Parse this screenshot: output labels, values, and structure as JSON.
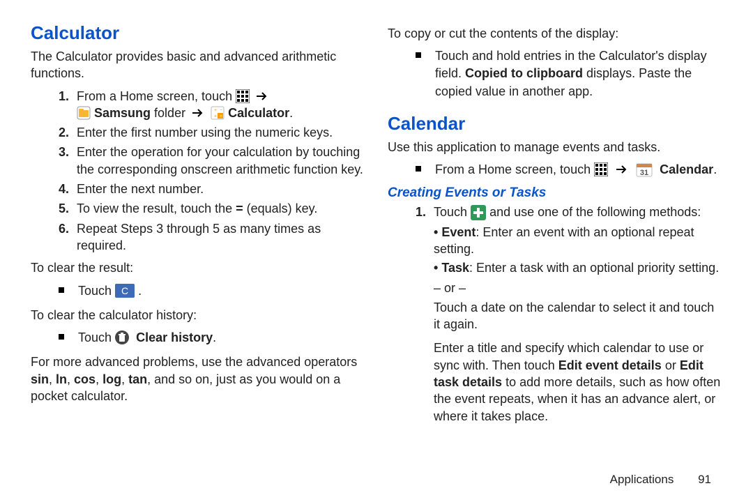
{
  "calculator": {
    "heading": "Calculator",
    "intro": "The Calculator provides basic and advanced arithmetic functions.",
    "step1_pre": "From a Home screen, touch ",
    "step1_samsung": "Samsung",
    "step1_folder": " folder ",
    "step1_calc": "Calculator",
    "step1_period": ".",
    "step2": "Enter the first number using the numeric keys.",
    "step3": "Enter the operation for your calculation by touching the corresponding onscreen arithmetic function key.",
    "step4": "Enter the next number.",
    "step5_pre": "To view the result, touch the ",
    "step5_eq": "=",
    "step5_post": " (equals) key.",
    "step6": "Repeat Steps 3 through 5 as many times as required.",
    "clear_result_intro": "To clear the result:",
    "clear_result_item_pre": "Touch ",
    "clear_result_item_post": " .",
    "clear_history_intro": "To clear the calculator history:",
    "clear_history_item_pre": "Touch ",
    "clear_history_label": "Clear history",
    "clear_history_item_post": ".",
    "advanced_pre": "For more advanced problems, use the advanced operators ",
    "adv_sin": "sin",
    "adv_sep1": ", ",
    "adv_ln": "ln",
    "adv_sep2": ", ",
    "adv_cos": "cos",
    "adv_sep3": ", ",
    "adv_log": "log",
    "adv_sep4": ", ",
    "adv_tan": "tan",
    "advanced_post": ", and so on, just as you would on a pocket calculator.",
    "copy_intro": "To copy or cut the contents of the display:",
    "copy_item_pre": "Touch and hold entries in the Calculator's display field. ",
    "copy_item_bold": "Copied to clipboard",
    "copy_item_post": " displays. Paste the copied value in another app."
  },
  "calendar": {
    "heading": "Calendar",
    "intro": "Use this application to manage events and tasks.",
    "open_pre": "From a Home screen, touch ",
    "open_label": "Calendar",
    "open_post": ".",
    "sub_heading": "Creating Events or Tasks",
    "step1_pre": "Touch ",
    "step1_post": " and use one of the following methods:",
    "event_label": "Event",
    "event_desc": ": Enter an event with an optional repeat setting.",
    "task_label": "Task",
    "task_desc": ": Enter a task with an optional priority setting.",
    "or_text": "– or –",
    "touch_date": "Touch a date on the calendar to select it and touch it again.",
    "enter_title_pre": "Enter a title and specify which calendar to use or sync with. Then touch ",
    "edit_event": "Edit event details",
    "enter_title_mid": " or ",
    "edit_task": "Edit task details",
    "enter_title_post": " to add more details, such as how often the event repeats, when it has an advance alert, or where it takes place."
  },
  "nums": {
    "n1": "1.",
    "n2": "2.",
    "n3": "3.",
    "n4": "4.",
    "n5": "5.",
    "n6": "6."
  },
  "footer": {
    "chapter": "Applications",
    "page": "91"
  }
}
